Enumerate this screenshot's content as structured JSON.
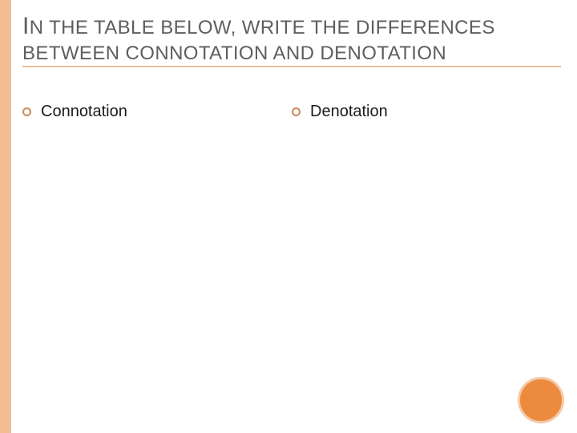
{
  "title": {
    "line1_lead": "I",
    "line1_rest": "N THE TABLE BELOW, WRITE THE DIFFERENCES",
    "line2": "BETWEEN CONNOTATION AND DENOTATION"
  },
  "columns": {
    "left": {
      "label": "Connotation"
    },
    "right": {
      "label": "Denotation"
    }
  }
}
